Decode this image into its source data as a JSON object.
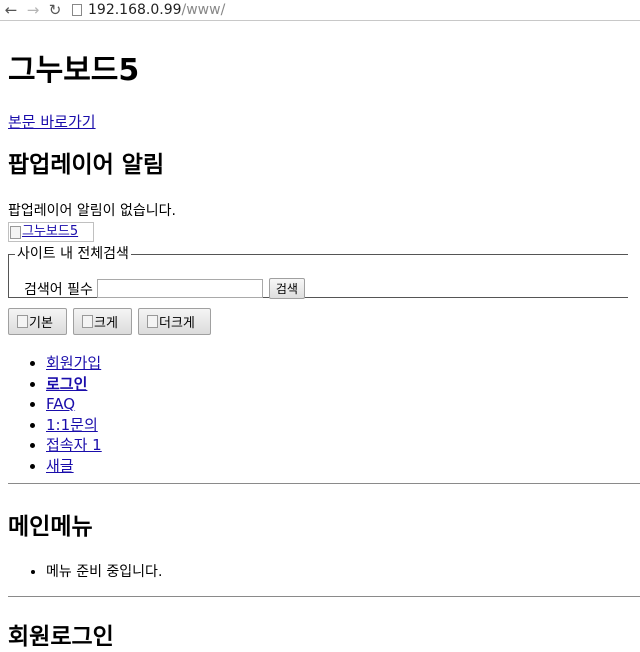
{
  "browser": {
    "back_icon": "arrow-left-icon",
    "forward_icon": "arrow-right-icon",
    "reload_icon": "reload-icon",
    "url_host": "192.168.0.99",
    "url_path": "/www/"
  },
  "page": {
    "site_title": "그누보드5",
    "skip_link": "본문 바로가기",
    "popup_heading": "팝업레이어 알림",
    "popup_empty": "팝업레이어 알림이 없습니다.",
    "logo_alt": "그누보드5"
  },
  "search": {
    "legend": "사이트 내 전체검색",
    "label": "검색어 필수",
    "value": "",
    "button": "검색"
  },
  "font_buttons": [
    {
      "label": "기본"
    },
    {
      "label": "크게"
    },
    {
      "label": "더크게"
    }
  ],
  "gnb": [
    {
      "label": "회원가입"
    },
    {
      "label": "로그인"
    },
    {
      "label": "FAQ"
    },
    {
      "label": "1:1문의"
    },
    {
      "label": "접속자 1"
    },
    {
      "label": "새글"
    }
  ],
  "main_menu": {
    "heading": "메인메뉴",
    "empty": "메뉴 준비 중입니다."
  },
  "login": {
    "heading": "회원로그인"
  }
}
